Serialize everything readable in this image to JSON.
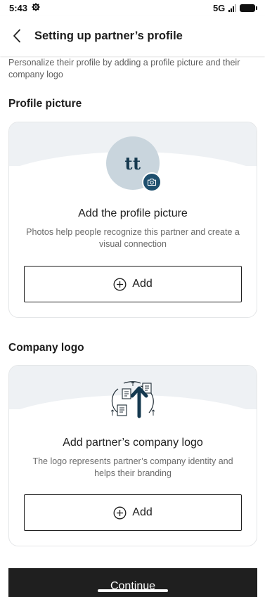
{
  "status_bar": {
    "time": "5:43",
    "network": "5G"
  },
  "header": {
    "title": "Setting up partner’s profile"
  },
  "intro_text": "Personalize their profile by adding a profile picture and their company logo",
  "profile_picture": {
    "section_title": "Profile picture",
    "initials": "tt",
    "heading": "Add the profile picture",
    "description": "Photos help people recognize this partner and create a visual connection",
    "button_label": "Add"
  },
  "company_logo": {
    "section_title": "Company logo",
    "heading": "Add partner’s company logo",
    "description": "The logo represents partner’s company identity and helps their branding",
    "button_label": "Add"
  },
  "footer": {
    "continue_label": "Continue"
  },
  "colors": {
    "accent_dark": "#1e4f6e",
    "avatar_bg": "#c9d5dd",
    "button_dark": "#1f1f1f",
    "banner_bg": "#eef1f4"
  }
}
